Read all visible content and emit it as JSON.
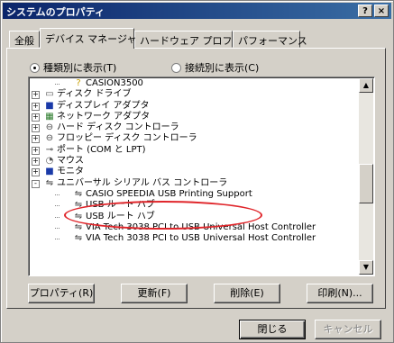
{
  "window": {
    "title": "システムのプロパティ",
    "help_label": "?",
    "close_label": "×"
  },
  "tabs": [
    {
      "label": "全般"
    },
    {
      "label": "デバイス マネージャ"
    },
    {
      "label": "ハードウェア プロファイル"
    },
    {
      "label": "パフォーマンス"
    }
  ],
  "view_options": {
    "by_type": "種類別に表示(T)",
    "by_connection": "接続別に表示(C)",
    "selected": "by_type"
  },
  "tree": [
    {
      "label": "CASION3500",
      "icon": "question-icon",
      "glyph": "?"
    },
    {
      "label": "ディスク ドライブ",
      "icon": "disk-drive-icon",
      "glyph": "▭"
    },
    {
      "label": "ディスプレイ アダプタ",
      "icon": "display-icon",
      "glyph": "■"
    },
    {
      "label": "ネットワーク アダプタ",
      "icon": "network-icon",
      "glyph": "▦"
    },
    {
      "label": "ハード ディスク コントローラ",
      "icon": "disk-controller-icon",
      "glyph": "⊖"
    },
    {
      "label": "フロッピー ディスク コントローラ",
      "icon": "floppy-controller-icon",
      "glyph": "⊖"
    },
    {
      "label": "ポート (COM と LPT)",
      "icon": "port-icon",
      "glyph": "⊸"
    },
    {
      "label": "マウス",
      "icon": "mouse-icon",
      "glyph": "◔"
    },
    {
      "label": "モニタ",
      "icon": "monitor-icon",
      "glyph": "■"
    },
    {
      "label": "ユニバーサル シリアル バス コントローラ",
      "icon": "usb-icon",
      "glyph": "⇋"
    },
    {
      "label": "CASIO SPEEDIA USB Printing Support",
      "icon": "usb-icon",
      "glyph": "⇋"
    },
    {
      "label": "USB ルート ハブ",
      "icon": "usb-icon",
      "glyph": "⇋"
    },
    {
      "label": "USB ルート ハブ",
      "icon": "usb-icon",
      "glyph": "⇋"
    },
    {
      "label": "VIA Tech 3038 PCI to USB Universal Host Controller",
      "icon": "usb-icon",
      "glyph": "⇋"
    },
    {
      "label": "VIA Tech 3038 PCI to USB Universal Host Controller",
      "icon": "usb-icon",
      "glyph": "⇋"
    }
  ],
  "scroll_up_glyph": "▲",
  "scroll_down_glyph": "▼",
  "actions": {
    "properties": "プロパティ(R)",
    "refresh": "更新(F)",
    "remove": "削除(E)",
    "print": "印刷(N)..."
  },
  "footer": {
    "close": "閉じる",
    "cancel": "キャンセル"
  },
  "colors": {
    "annotation": "#e0262b",
    "title_bar": "#0a246a"
  }
}
